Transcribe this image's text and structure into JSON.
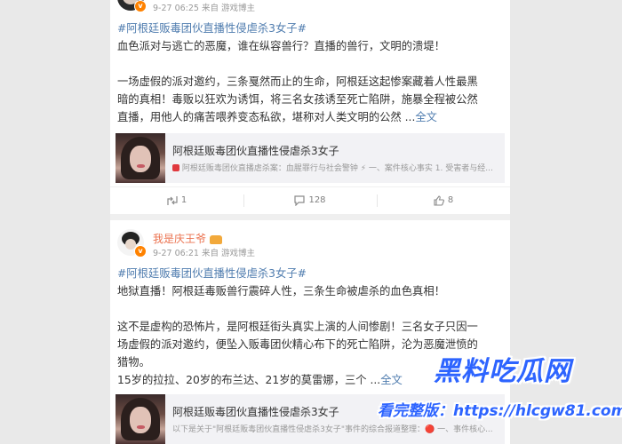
{
  "post1": {
    "meta": "9-27 06:25 来自 游戏博主",
    "hashtag": "#阿根廷贩毒团伙直播性侵虐杀3女子#",
    "line1": "血色派对与逃亡的恶魔，谁在纵容兽行？直播的兽行，文明的溃堤！",
    "para2_l1": "一场虚假的派对邀约，三条戛然而止的生命，阿根廷这起惨案藏着人性最黑",
    "para2_l2": "暗的真相！毒贩以狂欢为诱饵，将三名女孩诱至死亡陷阱，施暴全程被公然",
    "para2_l3": "直播，用他人的痛苦喂养变态私欲，堪称对人类文明的公然 ...",
    "more": "全文",
    "link_title": "阿根廷贩毒团伙直播性侵虐杀3女子",
    "link_desc": "阿根廷贩毒团伙直播虐杀案：血腥罪行与社会警钟 ⚡ 一、案件核心事实 1. 受害者与经...",
    "repost_count": "1",
    "comment_count": "128",
    "like_count": "8"
  },
  "post2": {
    "username": "我是庆王爷",
    "meta": "9-27 06:21 来自 游戏博主",
    "hashtag": "#阿根廷贩毒团伙直播性侵虐杀3女子#",
    "line1": "地狱直播！阿根廷毒贩兽行震碎人性，三条生命被虐杀的血色真相！",
    "para2_l1": "这不是虚构的恐怖片，是阿根廷街头真实上演的人间惨剧！三名女子只因一",
    "para2_l2": "场虚假的派对邀约，便坠入贩毒团伙精心布下的死亡陷阱，沦为恶魔泄愤的",
    "para2_l3": "猎物。",
    "para3_l1": "15岁的拉拉、20岁的布兰达、21岁的莫雷娜，三个 ...",
    "more": "全文",
    "link_title": "阿根廷贩毒团伙直播性侵虐杀3女子",
    "link_desc": "以下是关于\"阿根廷贩毒团伙直播性侵虐杀3女子\"事件的综合报道整理：🔴 一、事件核心..."
  },
  "watermark": {
    "brand": "黑料吃瓜网",
    "url": "看完整版：https://hlcgw81.com"
  },
  "colors": {
    "link": "#507daf",
    "username": "#eb7350",
    "watermark": "#2d64ff"
  },
  "icons": [
    "repost-icon",
    "comment-icon",
    "like-icon",
    "verified-badge-icon",
    "crown-icon"
  ]
}
